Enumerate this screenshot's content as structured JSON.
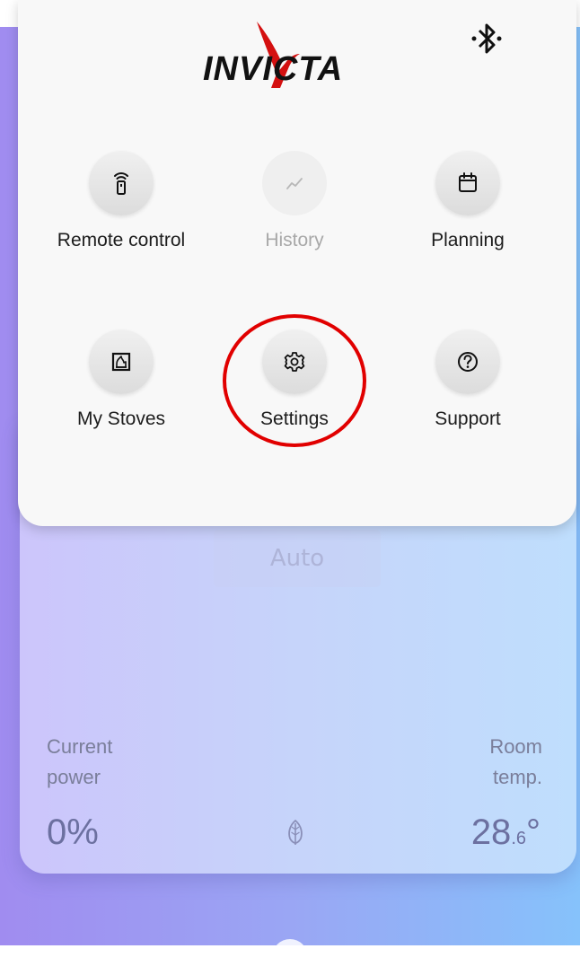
{
  "brand": {
    "logo_text": "INVICTA"
  },
  "menu": {
    "items": [
      {
        "label": "Remote control",
        "icon": "remote-icon",
        "enabled": true
      },
      {
        "label": "History",
        "icon": "chart-line-icon",
        "enabled": false
      },
      {
        "label": "Planning",
        "icon": "calendar-icon",
        "enabled": true
      },
      {
        "label": "My Stoves",
        "icon": "stove-icon",
        "enabled": true
      },
      {
        "label": "Settings",
        "icon": "gear-icon",
        "enabled": true
      },
      {
        "label": "Support",
        "icon": "help-icon",
        "enabled": true
      }
    ]
  },
  "stove": {
    "mode": "Auto",
    "current_power_label": "Current\npower",
    "current_power_value": "0%",
    "room_temp_label": "Room\ntemp.",
    "room_temp_value_main": "28",
    "room_temp_value_decimal": ".6",
    "room_temp_unit": "°"
  },
  "colors": {
    "highlight": "#e10000",
    "gradient_start": "#a08cf0",
    "gradient_end": "#86c2fb"
  }
}
